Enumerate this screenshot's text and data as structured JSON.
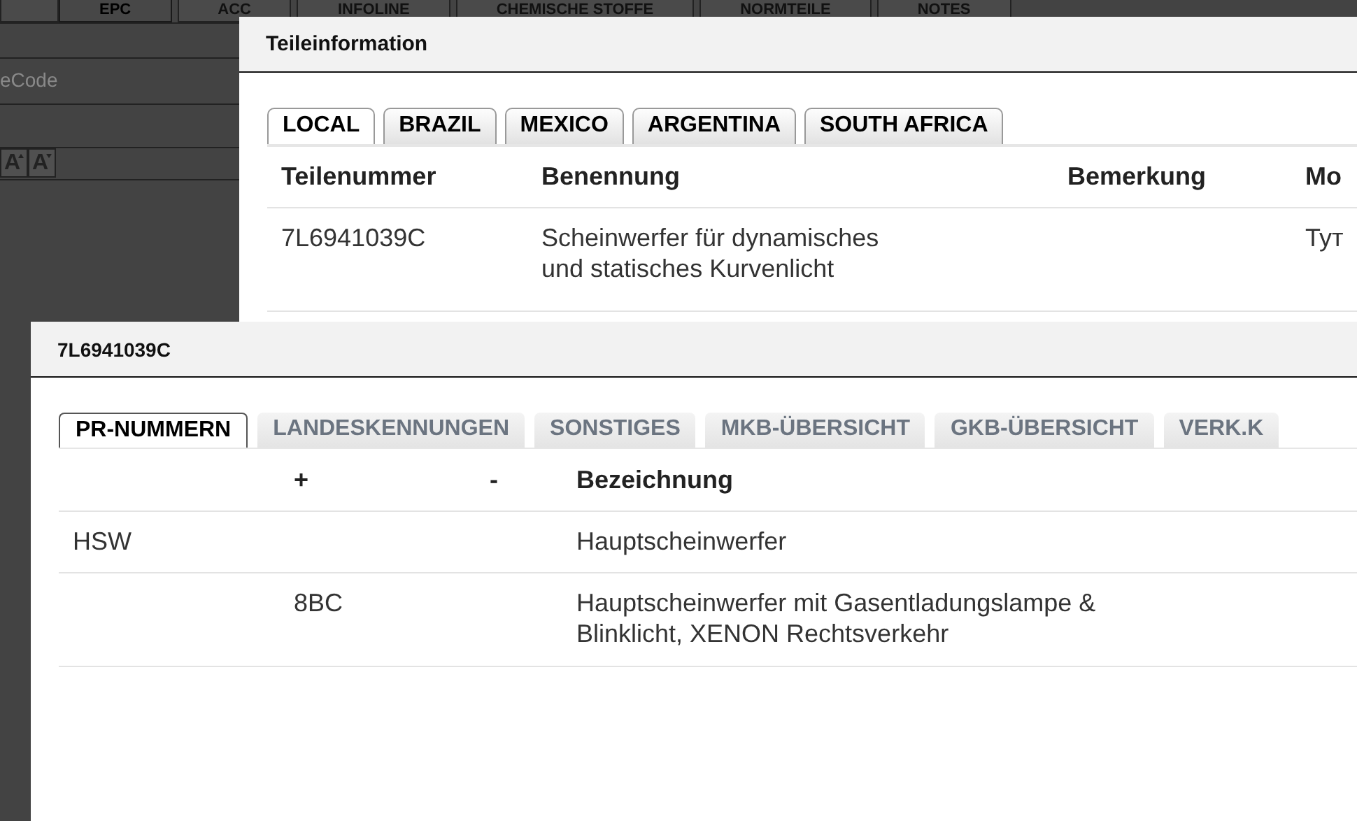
{
  "app_tabs": [
    {
      "label": "EPC",
      "selected": true
    },
    {
      "label": "ACC",
      "selected": false
    },
    {
      "label": "INFOLINE",
      "selected": false
    },
    {
      "label": "CHEMISCHE STOFFE",
      "selected": false
    },
    {
      "label": "NORMTEILE",
      "selected": false
    },
    {
      "label": "NOTES",
      "selected": false
    }
  ],
  "search_field": {
    "placeholder": "eCode"
  },
  "font_buttons": [
    {
      "kind": "increase",
      "label": "A"
    },
    {
      "kind": "decrease",
      "label": "A"
    }
  ],
  "part_dialog": {
    "title": "Teileinformation",
    "tabs": [
      {
        "label": "LOCAL",
        "selected": true
      },
      {
        "label": "BRAZIL",
        "selected": false
      },
      {
        "label": "MEXICO",
        "selected": false
      },
      {
        "label": "ARGENTINA",
        "selected": false
      },
      {
        "label": "SOUTH AFRICA",
        "selected": false
      }
    ],
    "columns": [
      "Teilenummer",
      "Benennung",
      "Bemerkung",
      "Mo"
    ],
    "rows": [
      {
        "cells": [
          "7L6941039C",
          "Scheinwerfer für dynamisches und statisches Kurvenlicht",
          null,
          "Тут"
        ]
      }
    ]
  },
  "pr_dialog": {
    "title": "7L6941039C",
    "tabs": [
      {
        "label": "PR-NUMMERN",
        "selected": true
      },
      {
        "label": "LANDESKENNUNGEN",
        "selected": false
      },
      {
        "label": "SONSTIGES",
        "selected": false
      },
      {
        "label": "MKB-ÜBERSICHT",
        "selected": false
      },
      {
        "label": "GKB-ÜBERSICHT",
        "selected": false
      },
      {
        "label": "VERK.K",
        "selected": false
      }
    ],
    "columns": [
      null,
      "+",
      "-",
      "Bezeichnung"
    ],
    "rows": [
      {
        "cells": [
          "HSW",
          null,
          null,
          "Hauptscheinwerfer"
        ]
      },
      {
        "cells": [
          null,
          "8BC",
          null,
          "Hauptscheinwerfer mit Gasentladungslampe & Blinklicht, XENON Rechtsverkehr"
        ]
      }
    ]
  }
}
